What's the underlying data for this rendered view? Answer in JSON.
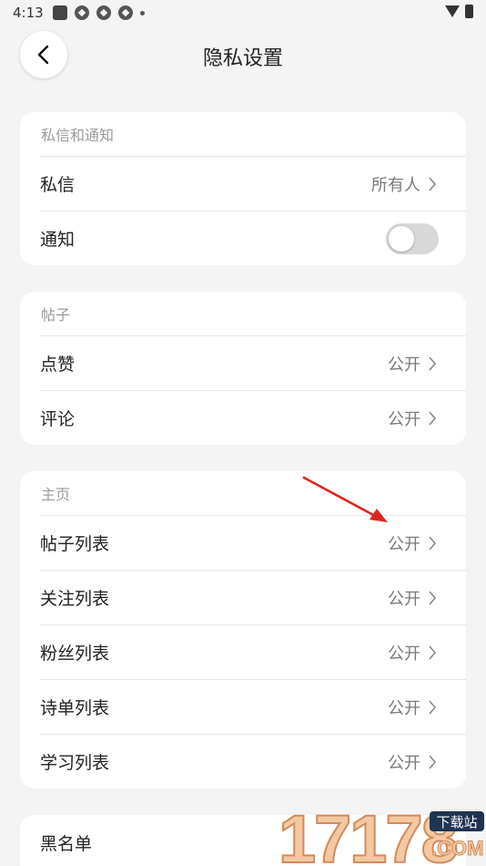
{
  "status_bar": {
    "time": "4:13"
  },
  "header": {
    "title": "隐私设置"
  },
  "sections": {
    "messages": {
      "title": "私信和通知",
      "private_message": {
        "label": "私信",
        "value": "所有人"
      },
      "notification": {
        "label": "通知",
        "toggle_on": false
      }
    },
    "posts": {
      "title": "帖子",
      "items": [
        {
          "label": "点赞",
          "value": "公开"
        },
        {
          "label": "评论",
          "value": "公开"
        }
      ]
    },
    "homepage": {
      "title": "主页",
      "items": [
        {
          "label": "帖子列表",
          "value": "公开"
        },
        {
          "label": "关注列表",
          "value": "公开"
        },
        {
          "label": "粉丝列表",
          "value": "公开"
        },
        {
          "label": "诗单列表",
          "value": "公开"
        },
        {
          "label": "学习列表",
          "value": "公开"
        }
      ]
    },
    "blacklist": {
      "label": "黑名单"
    }
  },
  "watermark": {
    "number": "17178",
    "site": "下载站",
    "domain": ".COM"
  },
  "colors": {
    "annotation_arrow": "#e0251b",
    "toggle_off": "#d9d9d9"
  }
}
